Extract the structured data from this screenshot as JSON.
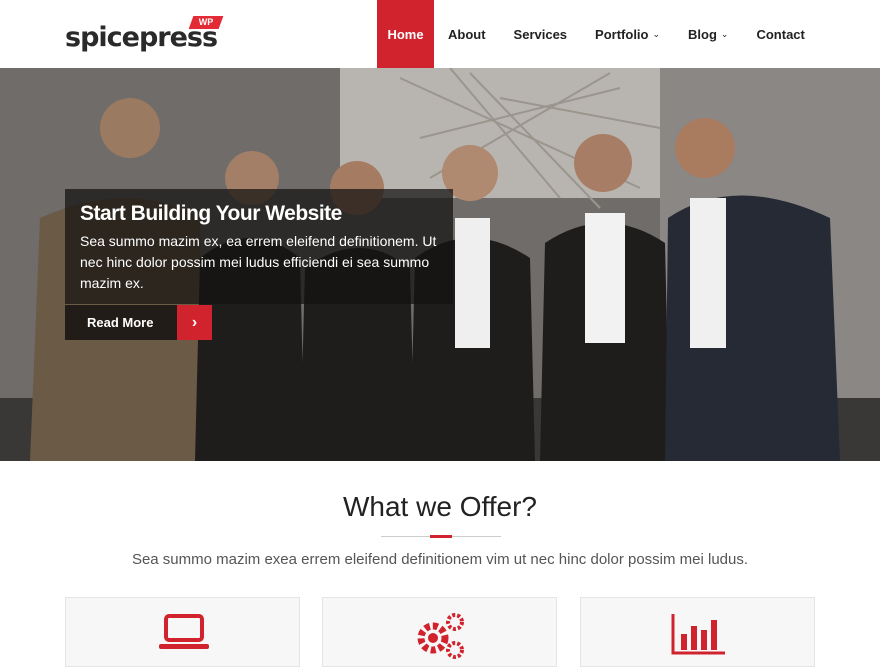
{
  "logo": {
    "text": "spicepress",
    "badge": "WP"
  },
  "nav": {
    "items": [
      {
        "label": "Home",
        "active": true
      },
      {
        "label": "About"
      },
      {
        "label": "Services"
      },
      {
        "label": "Portfolio",
        "dropdown": true
      },
      {
        "label": "Blog",
        "dropdown": true
      },
      {
        "label": "Contact"
      }
    ]
  },
  "hero": {
    "title": "Start Building Your Website",
    "text": "Sea summo mazim ex, ea errem eleifend definitionem. Ut nec hinc dolor possim mei ludus efficiendi ei sea summo mazim ex.",
    "button": "Read More"
  },
  "offer": {
    "title": "What we Offer?",
    "description": "Sea summo mazim exea errem eleifend definitionem vim ut nec hinc dolor possim mei ludus.",
    "cards": [
      {
        "icon": "laptop-icon"
      },
      {
        "icon": "gears-icon"
      },
      {
        "icon": "bar-chart-icon"
      }
    ]
  },
  "colors": {
    "accent": "#d0232d"
  }
}
